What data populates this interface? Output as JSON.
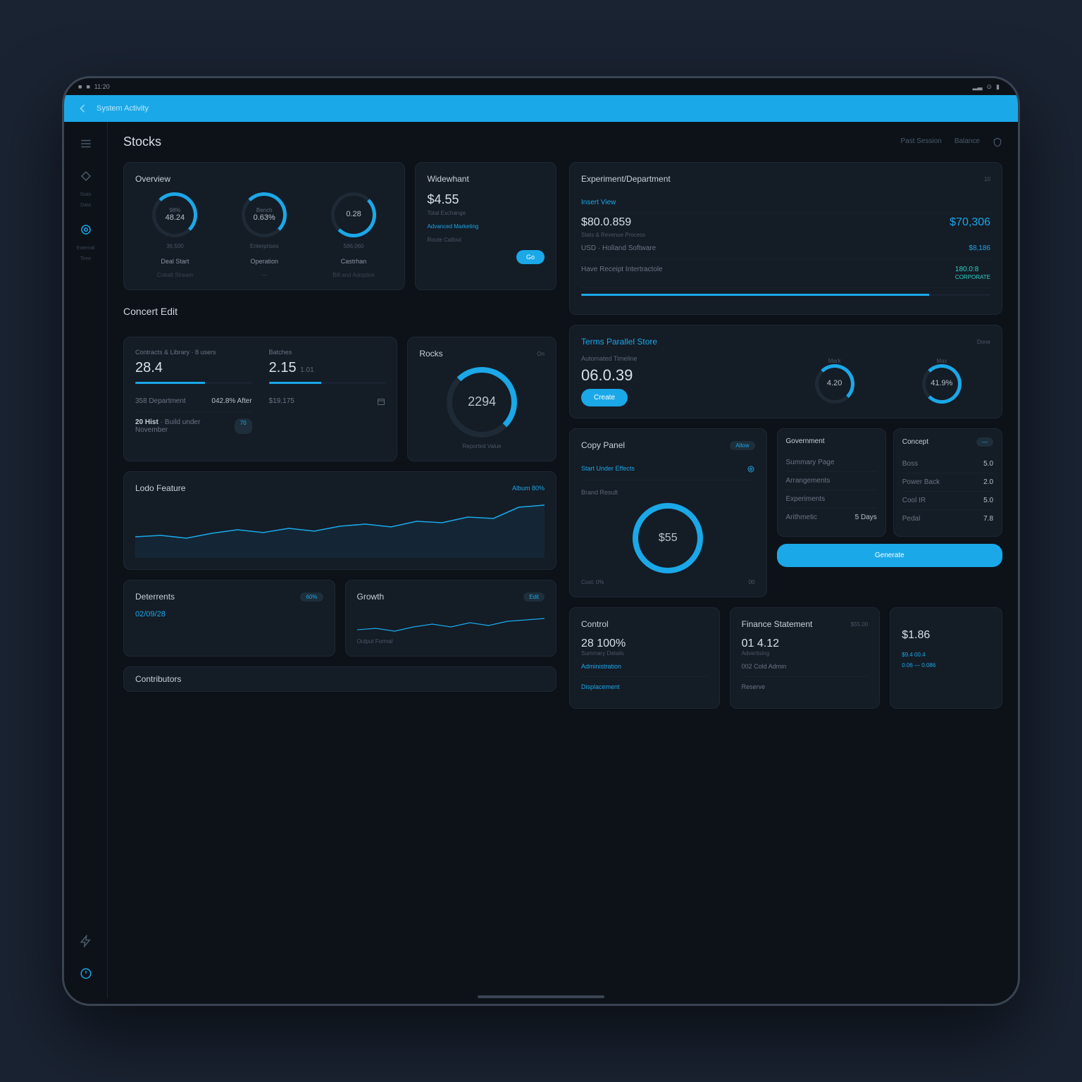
{
  "status": {
    "time": "11:20",
    "right": [
      "▂▃",
      "⊙",
      "▮"
    ]
  },
  "banner": {
    "text": "System Activity"
  },
  "sidebar": [
    {
      "icon": "menu",
      "label": ""
    },
    {
      "icon": "tag",
      "label": "Stats",
      "sub": "Data"
    },
    {
      "icon": "target",
      "label": "",
      "active": true
    },
    {
      "icon": "stack",
      "label": "External",
      "sub": "Time"
    },
    {
      "icon": "bolt",
      "label": ""
    }
  ],
  "page_title": "Stocks",
  "hdr_tabs": [
    "Past Session",
    "Balance"
  ],
  "overview": {
    "title": "Overview",
    "gauges": [
      {
        "top": "98%",
        "val": "48.24",
        "sub": "36,500",
        "cap": "Deal Start",
        "foot": "Cobalt Stream"
      },
      {
        "top": "Bench",
        "val": "0.63%",
        "sub": "Enterprises",
        "cap": "Operation",
        "foot": "—"
      },
      {
        "top": "",
        "val": "0.28",
        "sub": "586,060",
        "cap": "Castrhan",
        "foot": "Bill and Adoption"
      }
    ]
  },
  "widewhant": {
    "title": "Widewhant",
    "big": "$4.55",
    "sub": "Total Exchange",
    "r2": "Advanced Marketing",
    "r3": "Route Callout",
    "btn": "Go"
  },
  "exper": {
    "title": "Experiment/Department",
    "sub": "10",
    "rows": [
      {
        "l": "Insert View",
        "r": ""
      },
      {
        "l": "Stats & Revenue Process",
        "sub": "Stats & Revenue Process"
      },
      {
        "l": "USD · Holland Software",
        "r": "$8,186"
      },
      {
        "l": "Have Receipt Intertractole",
        "r": "180.0:8",
        "sub": "CORPORATE"
      }
    ]
  },
  "concert": {
    "title": "Concert Edit",
    "left": {
      "lbl": "Contracts & Library",
      "sub": "8 users",
      "val": "28.4",
      "bar": 60,
      "r2l": "358 Department",
      "r2r": "042.8% After",
      "r3": "20 Hist",
      "r3sub": "Build under November",
      "r3b": "70"
    },
    "right": {
      "lbl": "Batches",
      "val": "2.15",
      "sub": "1.01",
      "r2": "$19,175",
      "r2icon": "cal"
    },
    "ring": {
      "title": "Rocks",
      "val": "2294",
      "sub": "Reported Value"
    }
  },
  "terms": {
    "title": "Terms Parallel Store",
    "badge": "Done",
    "main": {
      "lbl": "Automated Timeline",
      "val": "06.0.39",
      "btn": "Create"
    },
    "g1": {
      "lbl": "Mark",
      "val": "4.20"
    },
    "g2": {
      "lbl": "Max",
      "val": "41.9%"
    }
  },
  "cpanel": {
    "title": "Copy Panel",
    "badge": "Allow",
    "rows": [
      {
        "l": "Start Under Effects",
        "i": "target"
      }
    ],
    "sub_title": "Brand Result",
    "ring": "$55",
    "rsub": "Cost: 0%",
    "rr": "00"
  },
  "cmp": {
    "a": {
      "title": "Government",
      "rows": [
        {
          "l": "Summary Page",
          "r": ""
        },
        {
          "l": "Arrangements",
          "r": ""
        },
        {
          "l": "Experiments",
          "r": ""
        },
        {
          "l": "Arithmetic",
          "r": "5 Days"
        }
      ]
    },
    "b": {
      "title": "Concept",
      "badge": "—",
      "rows": [
        {
          "l": "Boss",
          "r": "5.0"
        },
        {
          "l": "Power Back",
          "r": "2.0"
        },
        {
          "l": "Cool IR",
          "r": "5.0"
        },
        {
          "l": "Pedal",
          "r": "7.8"
        }
      ]
    },
    "btn": "Generate"
  },
  "feature": {
    "title": "Lodo Feature",
    "right": "Album 80%",
    "mini": [
      {
        "title": "Deterrents",
        "val": "02/09/28",
        "badge": "60%"
      },
      {
        "title": "Contributors",
        "val": ""
      },
      {
        "title": "Growth",
        "val": "",
        "sub": "Output Formal",
        "badge": "Edit"
      }
    ]
  },
  "bottom": {
    "a": {
      "title": "Control",
      "val": "28 100%",
      "sub": "Summary Details",
      "r2": "Administration",
      "r3": "Displacement"
    },
    "b": {
      "title": "Finance Statement",
      "sub": "$55.00",
      "val": "01 4.12",
      "sub2": "Advertising",
      "r2": "002 Cold Admin",
      "r3": "Reserve"
    },
    "c": {
      "val": "$1.86",
      "r2": "$9.4 00.4",
      "r3": "0.06 — 0.086"
    }
  },
  "chart_data": [
    {
      "type": "line",
      "title": "Lodo Feature",
      "x": [
        0,
        1,
        2,
        3,
        4,
        5,
        6,
        7,
        8,
        9,
        10,
        11,
        12,
        13,
        14,
        15
      ],
      "series": [
        {
          "name": "main",
          "values": [
            40,
            42,
            38,
            45,
            50,
            46,
            52,
            48,
            55,
            58,
            54,
            62,
            60,
            68,
            66,
            90
          ]
        }
      ],
      "ylim": [
        30,
        100
      ]
    },
    {
      "type": "line",
      "title": "Growth",
      "x": [
        0,
        1,
        2,
        3,
        4,
        5,
        6,
        7,
        8,
        9,
        10
      ],
      "series": [
        {
          "name": "s",
          "values": [
            30,
            32,
            28,
            34,
            40,
            36,
            42,
            38,
            44,
            46,
            48
          ]
        }
      ],
      "ylim": [
        20,
        60
      ]
    },
    {
      "type": "line",
      "title": "Output Formal",
      "x": [
        0,
        1,
        2,
        3,
        4,
        5,
        6,
        7,
        8,
        9,
        10
      ],
      "series": [
        {
          "name": "s",
          "values": [
            20,
            22,
            28,
            24,
            30,
            26,
            34,
            32,
            38,
            36,
            42
          ]
        }
      ],
      "ylim": [
        15,
        50
      ]
    }
  ]
}
